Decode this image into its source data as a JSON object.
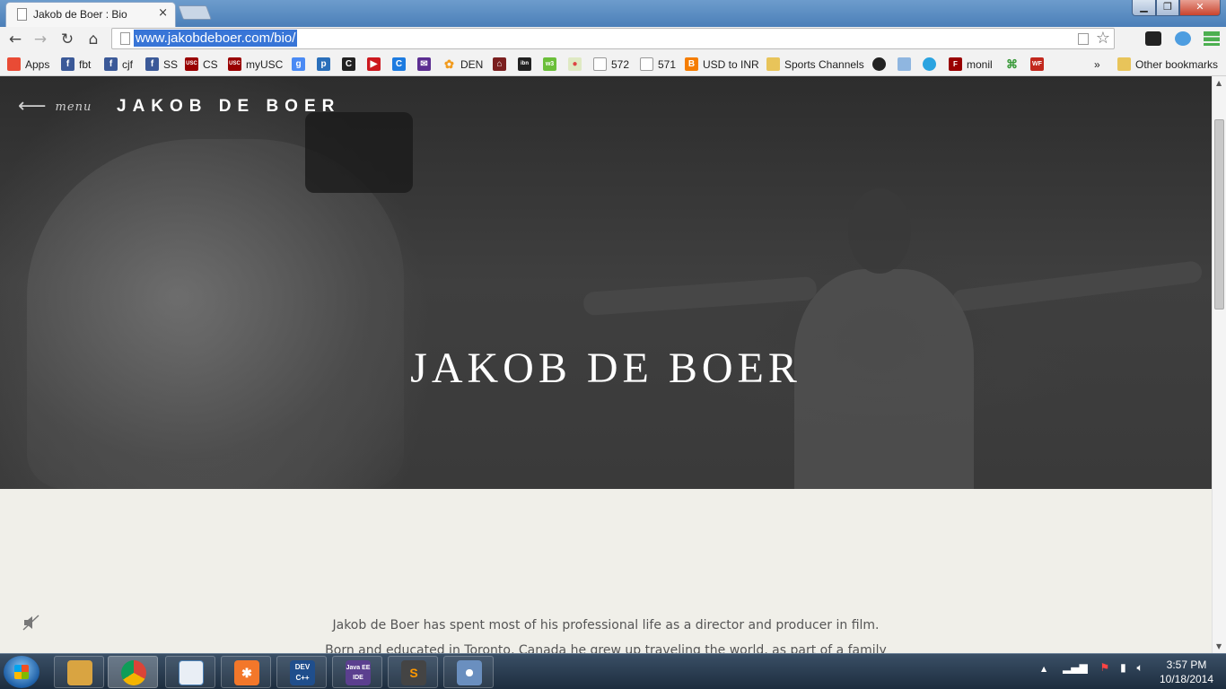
{
  "browser": {
    "tab_title": "Jakob de Boer : Bio",
    "tab_close": "×",
    "url": "www.jakobdeboer.com/bio/",
    "win_min": "▁",
    "win_max": "❐",
    "win_close": "✕",
    "nav": {
      "back": "←",
      "forward": "→",
      "reload": "↻",
      "home": "⌂"
    },
    "star": "☆"
  },
  "bookmarks": {
    "items": [
      {
        "label": "Apps",
        "icon": "apps-grid-icon",
        "color": "#e94b35"
      },
      {
        "label": "fbt",
        "icon": "facebook-icon",
        "color": "#3b5998"
      },
      {
        "label": "cjf",
        "icon": "facebook-icon",
        "color": "#3b5998"
      },
      {
        "label": "SS",
        "icon": "facebook-icon",
        "color": "#3b5998"
      },
      {
        "label": "CS",
        "icon": "usc-icon",
        "color": "#990000"
      },
      {
        "label": "myUSC",
        "icon": "usc-icon",
        "color": "#990000"
      },
      {
        "label": "572",
        "icon": "page-icon",
        "color": "#ffffff"
      },
      {
        "label": "571",
        "icon": "page-icon",
        "color": "#ffffff"
      },
      {
        "label": "USD to INR",
        "icon": "blogger-icon",
        "color": "#f57d00"
      },
      {
        "label": "Sports Channels",
        "icon": "folder-icon",
        "color": "#e8c45a"
      },
      {
        "label": "monil",
        "icon": "usc-icon",
        "color": "#990000"
      },
      {
        "label": "DEN",
        "icon": "flower-icon",
        "color": "#f29b1d"
      }
    ],
    "overflow": "»",
    "other": "Other bookmarks"
  },
  "page": {
    "menu_arrow": "⟵",
    "menu_label": "menu",
    "site_title": "JAKOB DE BOER",
    "hero_title": "JAKOB DE BOER",
    "bio_line1": "Jakob de Boer has spent most of his professional life as a director and producer in film.",
    "bio_line2": "Born and educated in Toronto, Canada he grew up traveling the world, as part of a family"
  },
  "taskbar": {
    "apps": [
      {
        "name": "file-explorer",
        "label": "",
        "color": "#d9a441"
      },
      {
        "name": "chrome",
        "label": "",
        "color": "#db4437"
      },
      {
        "name": "notepad",
        "label": "",
        "color": "#4a7fb5"
      },
      {
        "name": "xampp",
        "label": "",
        "color": "#f3772a"
      },
      {
        "name": "dev-cpp",
        "label": "DEV C++",
        "color": "#1f4e8c"
      },
      {
        "name": "java-ee-ide",
        "label": "Java EE IDE",
        "color": "#5b3f8f"
      },
      {
        "name": "sublime-text",
        "label": "S",
        "color": "#ff9800"
      },
      {
        "name": "paint",
        "label": "",
        "color": "#6a8fbf"
      }
    ],
    "time": "3:57 PM",
    "date": "10/18/2014",
    "tray_arrow": "▲"
  }
}
